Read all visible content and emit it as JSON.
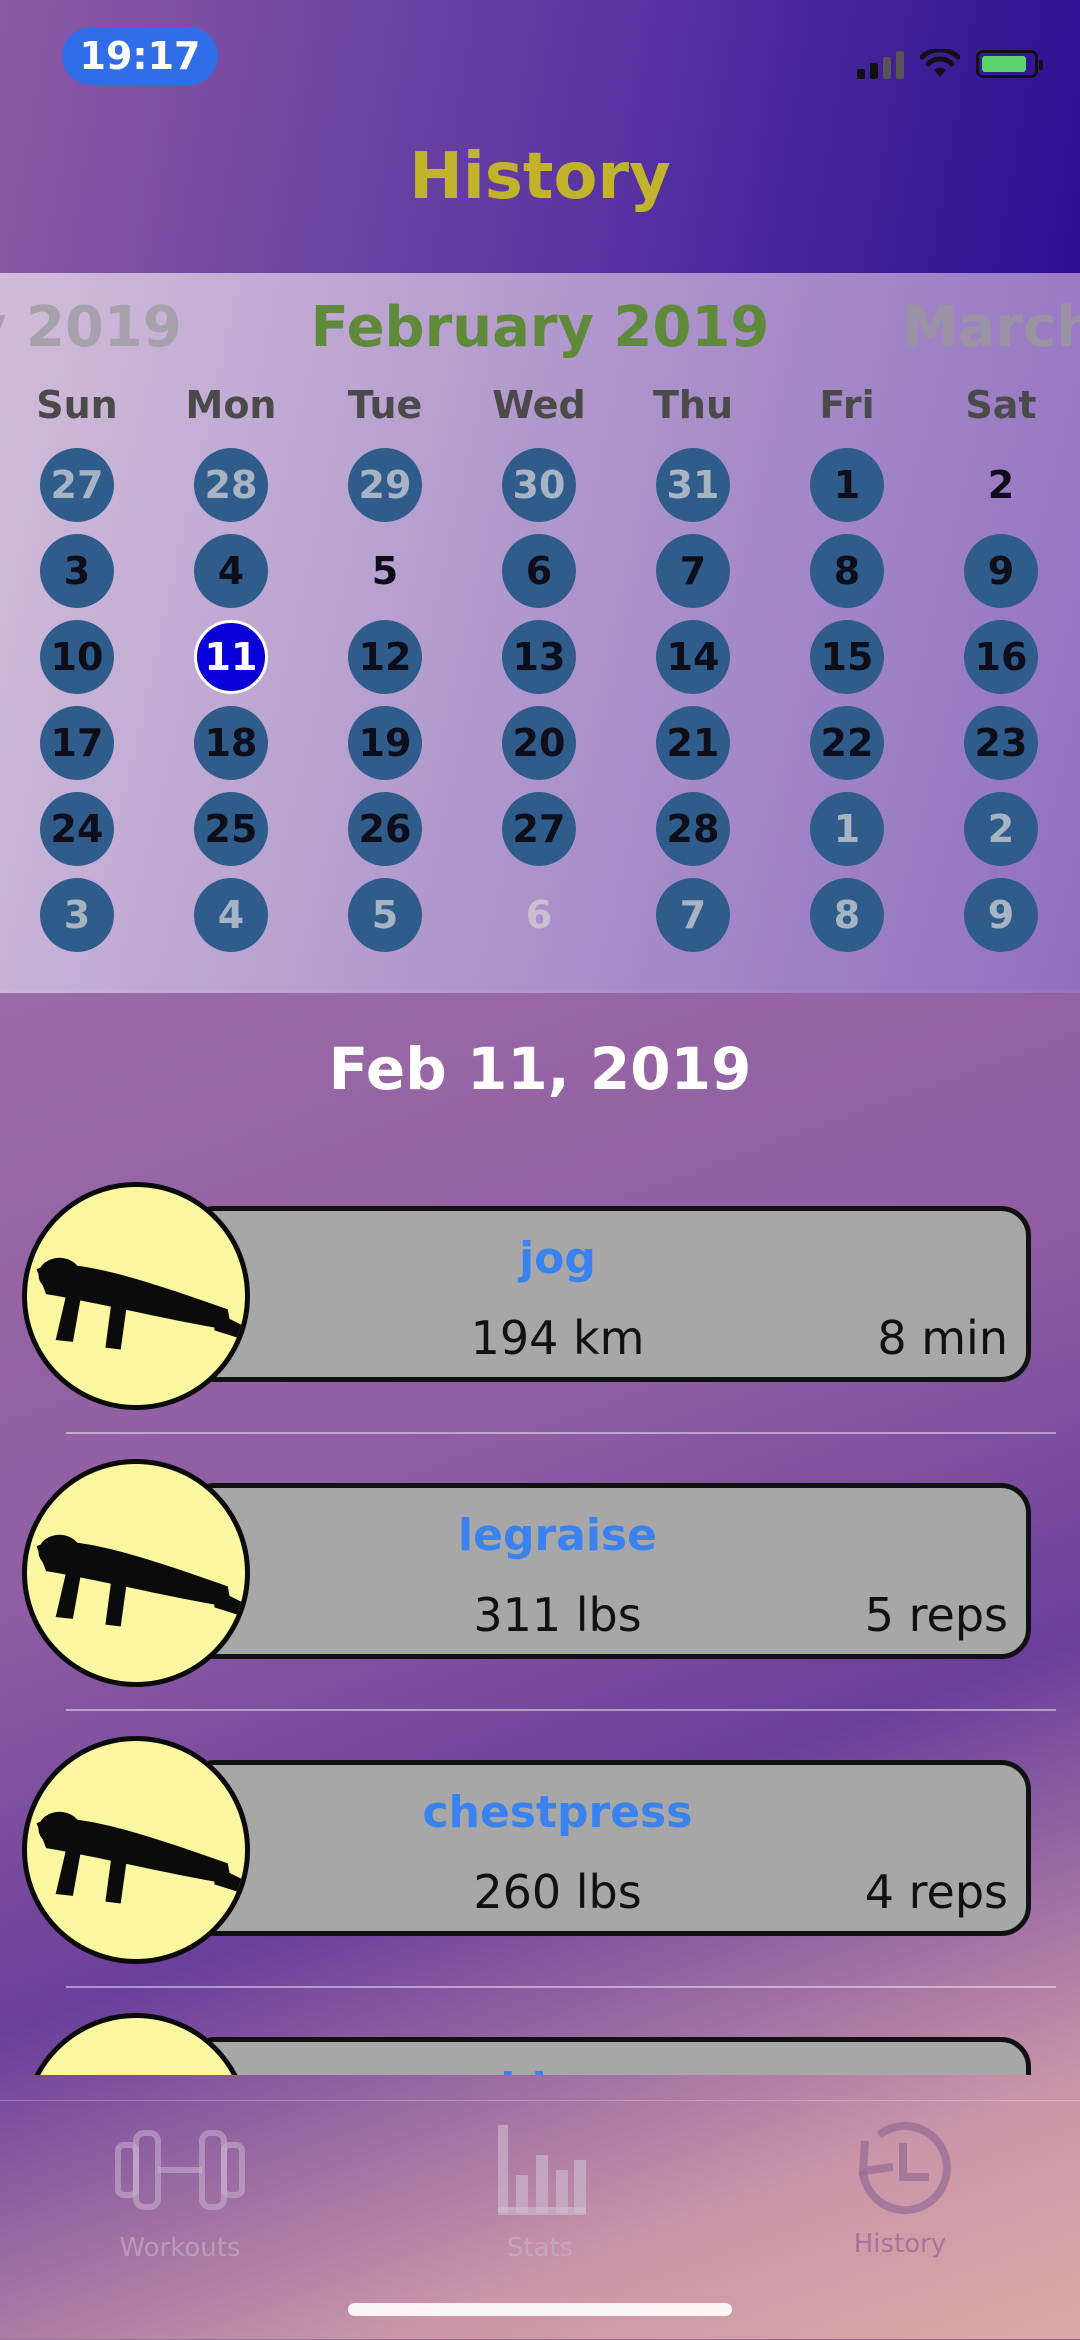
{
  "status_bar": {
    "time": "19:17"
  },
  "header": {
    "title": "History"
  },
  "calendar": {
    "prev_month": "y 2019",
    "current_month": "February 2019",
    "next_month": "March",
    "weekdays": [
      "Sun",
      "Mon",
      "Tue",
      "Wed",
      "Thu",
      "Fri",
      "Sat"
    ],
    "weeks": [
      [
        {
          "d": "27",
          "out": true,
          "mark": true
        },
        {
          "d": "28",
          "out": true,
          "mark": true
        },
        {
          "d": "29",
          "out": true,
          "mark": true
        },
        {
          "d": "30",
          "out": true,
          "mark": true
        },
        {
          "d": "31",
          "out": true,
          "mark": true
        },
        {
          "d": "1",
          "mark": true
        },
        {
          "d": "2"
        }
      ],
      [
        {
          "d": "3",
          "mark": true
        },
        {
          "d": "4",
          "mark": true
        },
        {
          "d": "5"
        },
        {
          "d": "6",
          "mark": true
        },
        {
          "d": "7",
          "mark": true
        },
        {
          "d": "8",
          "mark": true
        },
        {
          "d": "9",
          "mark": true
        }
      ],
      [
        {
          "d": "10",
          "mark": true
        },
        {
          "d": "11",
          "selected": true
        },
        {
          "d": "12",
          "mark": true
        },
        {
          "d": "13",
          "mark": true
        },
        {
          "d": "14",
          "mark": true
        },
        {
          "d": "15",
          "mark": true
        },
        {
          "d": "16",
          "mark": true
        }
      ],
      [
        {
          "d": "17",
          "mark": true
        },
        {
          "d": "18",
          "mark": true
        },
        {
          "d": "19",
          "mark": true
        },
        {
          "d": "20",
          "mark": true
        },
        {
          "d": "21",
          "mark": true
        },
        {
          "d": "22",
          "mark": true
        },
        {
          "d": "23",
          "mark": true
        }
      ],
      [
        {
          "d": "24",
          "mark": true
        },
        {
          "d": "25",
          "mark": true
        },
        {
          "d": "26",
          "mark": true
        },
        {
          "d": "27",
          "mark": true
        },
        {
          "d": "28",
          "mark": true
        },
        {
          "d": "1",
          "out": true,
          "mark": true
        },
        {
          "d": "2",
          "out": true,
          "mark": true
        }
      ],
      [
        {
          "d": "3",
          "out": true,
          "mark": true
        },
        {
          "d": "4",
          "out": true,
          "mark": true
        },
        {
          "d": "5",
          "out": true,
          "mark": true
        },
        {
          "d": "6",
          "out": true
        },
        {
          "d": "7",
          "out": true,
          "mark": true
        },
        {
          "d": "8",
          "out": true,
          "mark": true
        },
        {
          "d": "9",
          "out": true,
          "mark": true
        }
      ]
    ]
  },
  "selected_date": "Feb 11, 2019",
  "workouts": [
    {
      "name": "jog",
      "amount": "194 km",
      "count": "8 min",
      "icon": "pushup-silhouette-icon"
    },
    {
      "name": "legraise",
      "amount": "311 lbs",
      "count": "5 reps",
      "icon": "pushup-silhouette-icon"
    },
    {
      "name": "chestpress",
      "amount": "260 lbs",
      "count": "4 reps",
      "icon": "pushup-silhouette-icon"
    },
    {
      "name": "chinup",
      "amount": "",
      "count": "",
      "icon": "pushup-silhouette-icon"
    }
  ],
  "tabs": [
    {
      "label": "Workouts",
      "icon": "dumbbell-icon"
    },
    {
      "label": "Stats",
      "icon": "bar-chart-icon"
    },
    {
      "label": "History",
      "icon": "history-clock-icon"
    }
  ],
  "colors": {
    "title": "#c2b42a",
    "month": "#5f8a3a",
    "marked_day": "#2f5c8a",
    "selected_day": "#0a00d8",
    "exercise_name": "#3a82f0",
    "avatar_fill": "#fbf6a0"
  }
}
